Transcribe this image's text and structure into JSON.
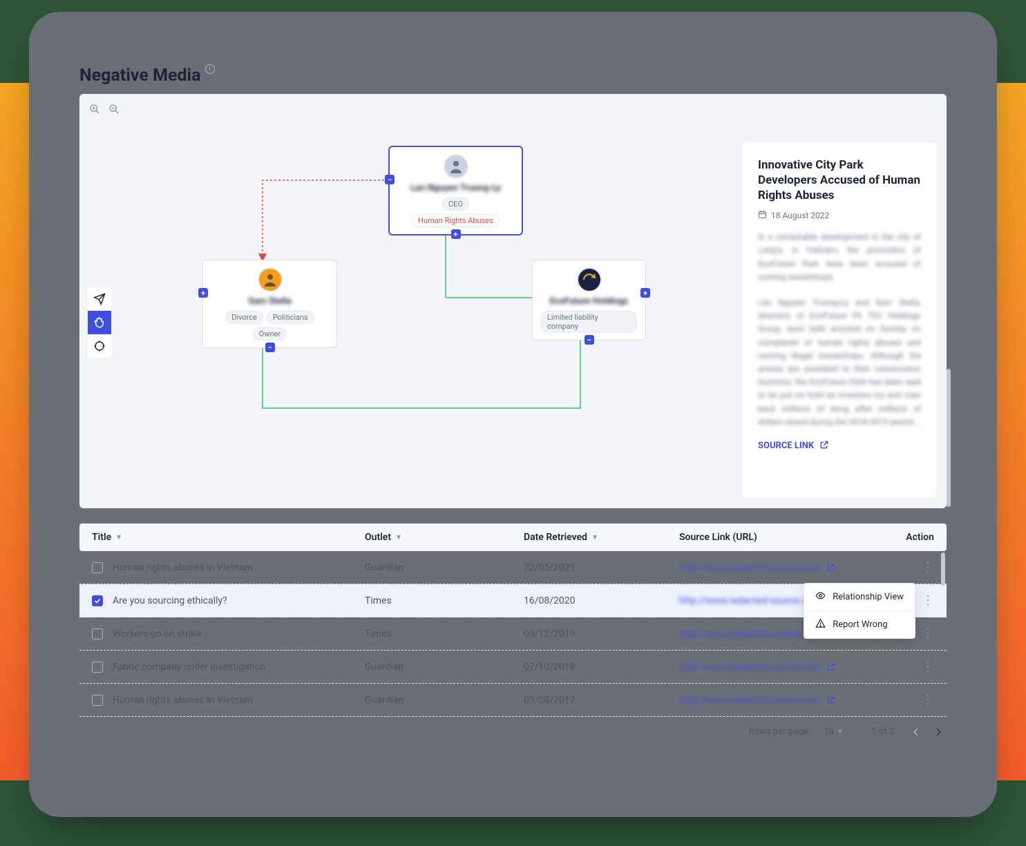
{
  "page": {
    "title": "Negative Media"
  },
  "graph": {
    "zoom_in_icon": "zoom-in",
    "zoom_out_icon": "zoom-out",
    "tools": {
      "select": "select",
      "pan": "pan",
      "target": "target"
    },
    "nodes": {
      "top": {
        "name": "Lan Nguyen Truong-Ly",
        "tags": [
          "CEO",
          "Human Rights Abuses"
        ]
      },
      "left": {
        "name": "Sam Stella",
        "tags": [
          "Divorce",
          "Politicians",
          "Owner"
        ]
      },
      "right": {
        "name": "EcoFuture Holdings",
        "tags": [
          "Limited liability company"
        ]
      }
    }
  },
  "article": {
    "title": "Innovative City Park Developers Accused of Human Rights Abuses",
    "date": "18 August 2022",
    "body_1": "In a remarkable development in the city of Lang'a, in Vietnam, the promoters of EcoFuture Park have been accused of running sweatshops.",
    "body_2": "Lan Nguyen Truong-Ly and Sam Stella, directors of EcoFuture FA TEC Holdings Group, were both arrested on Sunday on complaints of human rights abuses and running illegal sweatshops. Although the arrests are unrelated to their construction business, the EcoFuture Park has been said to be put on hold as investors try and claw back millions of dong after millions of dollars raised during the 2018-2019 period...",
    "source_link_label": "SOURCE LINK"
  },
  "table": {
    "headers": {
      "title": "Title",
      "outlet": "Outlet",
      "date": "Date Retrieved",
      "source": "Source Link (URL)",
      "action": "Action"
    },
    "rows": [
      {
        "title": "Human rights abuses in Vietnam",
        "outlet": "Guardian",
        "date": "22/05/2021",
        "url": "http://www.redacted-source.com",
        "checked": false
      },
      {
        "title": "Are you sourcing ethically?",
        "outlet": "Times",
        "date": "16/08/2020",
        "url": "http://www.redacted-source.com",
        "checked": true
      },
      {
        "title": "Workers go on strike",
        "outlet": "Times",
        "date": "03/12/2019",
        "url": "http://www.redacted-source.com",
        "checked": false
      },
      {
        "title": "Fabric company under investigation",
        "outlet": "Guardian",
        "date": "07/10/2018",
        "url": "http://www.redacted-source.com",
        "checked": false
      },
      {
        "title": "Human rights abuses in Vietnam",
        "outlet": "Guardian",
        "date": "09/08/2017",
        "url": "http://www.redacted-source.com",
        "checked": false
      }
    ],
    "row_menu": {
      "relationship": "Relationship View",
      "report": "Report Wrong"
    },
    "footer": {
      "rows_per_page_label": "Rows per page:",
      "rows_per_page_value": "10",
      "page_info": "1 of 2"
    }
  }
}
